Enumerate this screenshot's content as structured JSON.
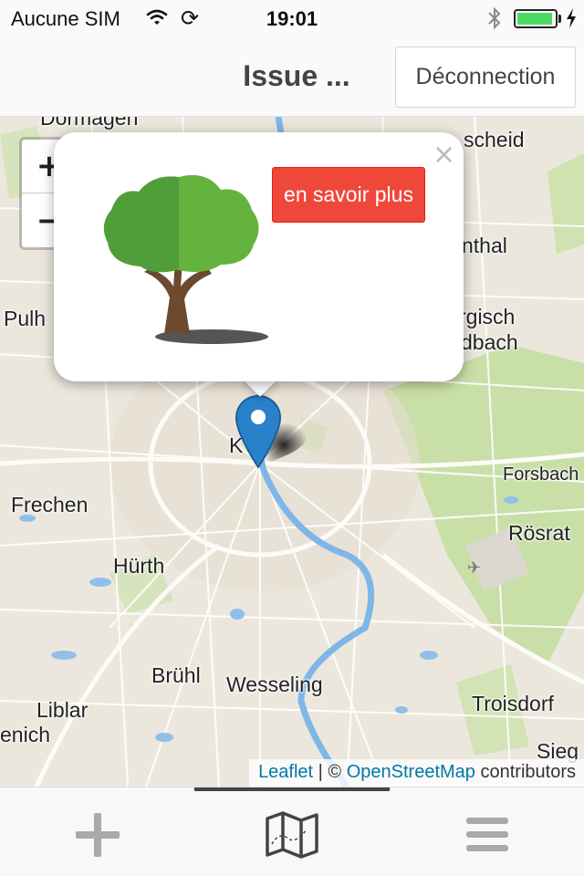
{
  "status_bar": {
    "carrier": "Aucune SIM",
    "time": "19:01",
    "icons": [
      "wifi-icon",
      "sync-icon",
      "bluetooth-icon",
      "battery-icon",
      "charging-icon"
    ],
    "battery_level": 0.95
  },
  "header": {
    "title": "Issue ...",
    "logout_label": "Déconnection"
  },
  "map": {
    "places": [
      "Dormagen",
      "scheid",
      "nthal",
      "Pulh",
      "rgisch",
      "dbach",
      "K",
      "Frechen",
      "Forsbach",
      "Rösrat",
      "Hürth",
      "Brühl",
      "Wesseling",
      "Liblar",
      "Troisdorf",
      "enich",
      "Sieg"
    ],
    "zoom_in_label": "+",
    "zoom_out_label": "−",
    "attribution": {
      "leaflet": "Leaflet",
      "separator": " | © ",
      "osm": "OpenStreetMap",
      "suffix": " contributors"
    },
    "marker_icon": "map-marker-icon"
  },
  "popup": {
    "close_label": "×",
    "image": "tree-icon",
    "button_label": "en savoir plus"
  },
  "tab_bar": {
    "tabs": [
      {
        "icon": "plus-icon"
      },
      {
        "icon": "map-icon",
        "active": true
      },
      {
        "icon": "menu-icon"
      }
    ]
  },
  "colors": {
    "button_red": "#ef473a",
    "marker_blue": "#2a81cb",
    "link_blue": "#0078a8",
    "battery_green": "#4cd964"
  }
}
